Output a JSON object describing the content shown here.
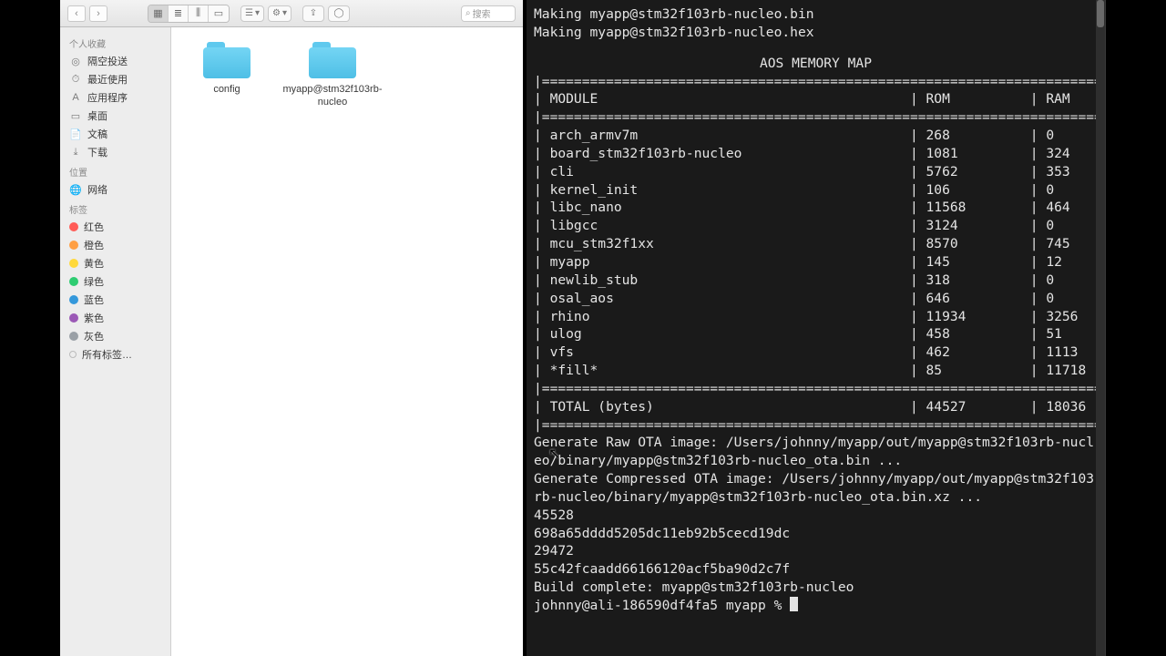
{
  "finder": {
    "search_placeholder": "搜索",
    "sidebar": {
      "fav_header": "个人收藏",
      "favorites": [
        {
          "icon": "◎",
          "label": "隔空投送"
        },
        {
          "icon": "⏱",
          "label": "最近使用"
        },
        {
          "icon": "A",
          "label": "应用程序"
        },
        {
          "icon": "▭",
          "label": "桌面"
        },
        {
          "icon": "📄",
          "label": "文稿"
        },
        {
          "icon": "⤓",
          "label": "下载"
        }
      ],
      "loc_header": "位置",
      "locations": [
        {
          "icon": "🌐",
          "label": "网络"
        }
      ],
      "tag_header": "标签",
      "tags": [
        {
          "color": "#ff5b56",
          "label": "红色"
        },
        {
          "color": "#ff9f43",
          "label": "橙色"
        },
        {
          "color": "#ffd93b",
          "label": "黄色"
        },
        {
          "color": "#2ecc71",
          "label": "绿色"
        },
        {
          "color": "#3498db",
          "label": "蓝色"
        },
        {
          "color": "#9b59b6",
          "label": "紫色"
        },
        {
          "color": "#9aa0a6",
          "label": "灰色"
        },
        {
          "color": "#d0d0d0",
          "label": "所有标签…",
          "hollow": true
        }
      ]
    },
    "folders": [
      {
        "name": "config"
      },
      {
        "name": "myapp@stm32f103rb-nucleo"
      }
    ]
  },
  "terminal": {
    "making_bin": "Making myapp@stm32f103rb-nucleo.bin",
    "making_hex": "Making myapp@stm32f103rb-nucleo.hex",
    "mem_title": "AOS MEMORY MAP",
    "rule": "|==========================================================================|",
    "col_module": "MODULE",
    "col_rom": "ROM",
    "col_ram": "RAM",
    "rows": [
      {
        "m": "arch_armv7m",
        "rom": "268",
        "ram": "0"
      },
      {
        "m": "board_stm32f103rb-nucleo",
        "rom": "1081",
        "ram": "324"
      },
      {
        "m": "cli",
        "rom": "5762",
        "ram": "353"
      },
      {
        "m": "kernel_init",
        "rom": "106",
        "ram": "0"
      },
      {
        "m": "libc_nano",
        "rom": "11568",
        "ram": "464"
      },
      {
        "m": "libgcc",
        "rom": "3124",
        "ram": "0"
      },
      {
        "m": "mcu_stm32f1xx",
        "rom": "8570",
        "ram": "745"
      },
      {
        "m": "myapp",
        "rom": "145",
        "ram": "12"
      },
      {
        "m": "newlib_stub",
        "rom": "318",
        "ram": "0"
      },
      {
        "m": "osal_aos",
        "rom": "646",
        "ram": "0"
      },
      {
        "m": "rhino",
        "rom": "11934",
        "ram": "3256"
      },
      {
        "m": "ulog",
        "rom": "458",
        "ram": "51"
      },
      {
        "m": "vfs",
        "rom": "462",
        "ram": "1113"
      },
      {
        "m": "*fill*",
        "rom": "85",
        "ram": "11718"
      }
    ],
    "total_label": "TOTAL (bytes)",
    "total_rom": "44527",
    "total_ram": "18036",
    "post": [
      "Generate Raw OTA image: /Users/johnny/myapp/out/myapp@stm32f103rb-nucl",
      "eo/binary/myapp@stm32f103rb-nucleo_ota.bin ...",
      "Generate Compressed OTA image: /Users/johnny/myapp/out/myapp@stm32f103",
      "rb-nucleo/binary/myapp@stm32f103rb-nucleo_ota.bin.xz ...",
      "45528",
      "698a65dddd5205dc11eb92b5cecd19dc",
      "29472",
      "55c42fcaadd66166120acf5ba90d2c7f",
      "Build complete: myapp@stm32f103rb-nucleo"
    ],
    "prompt": "johnny@ali-186590df4fa5 myapp % "
  }
}
